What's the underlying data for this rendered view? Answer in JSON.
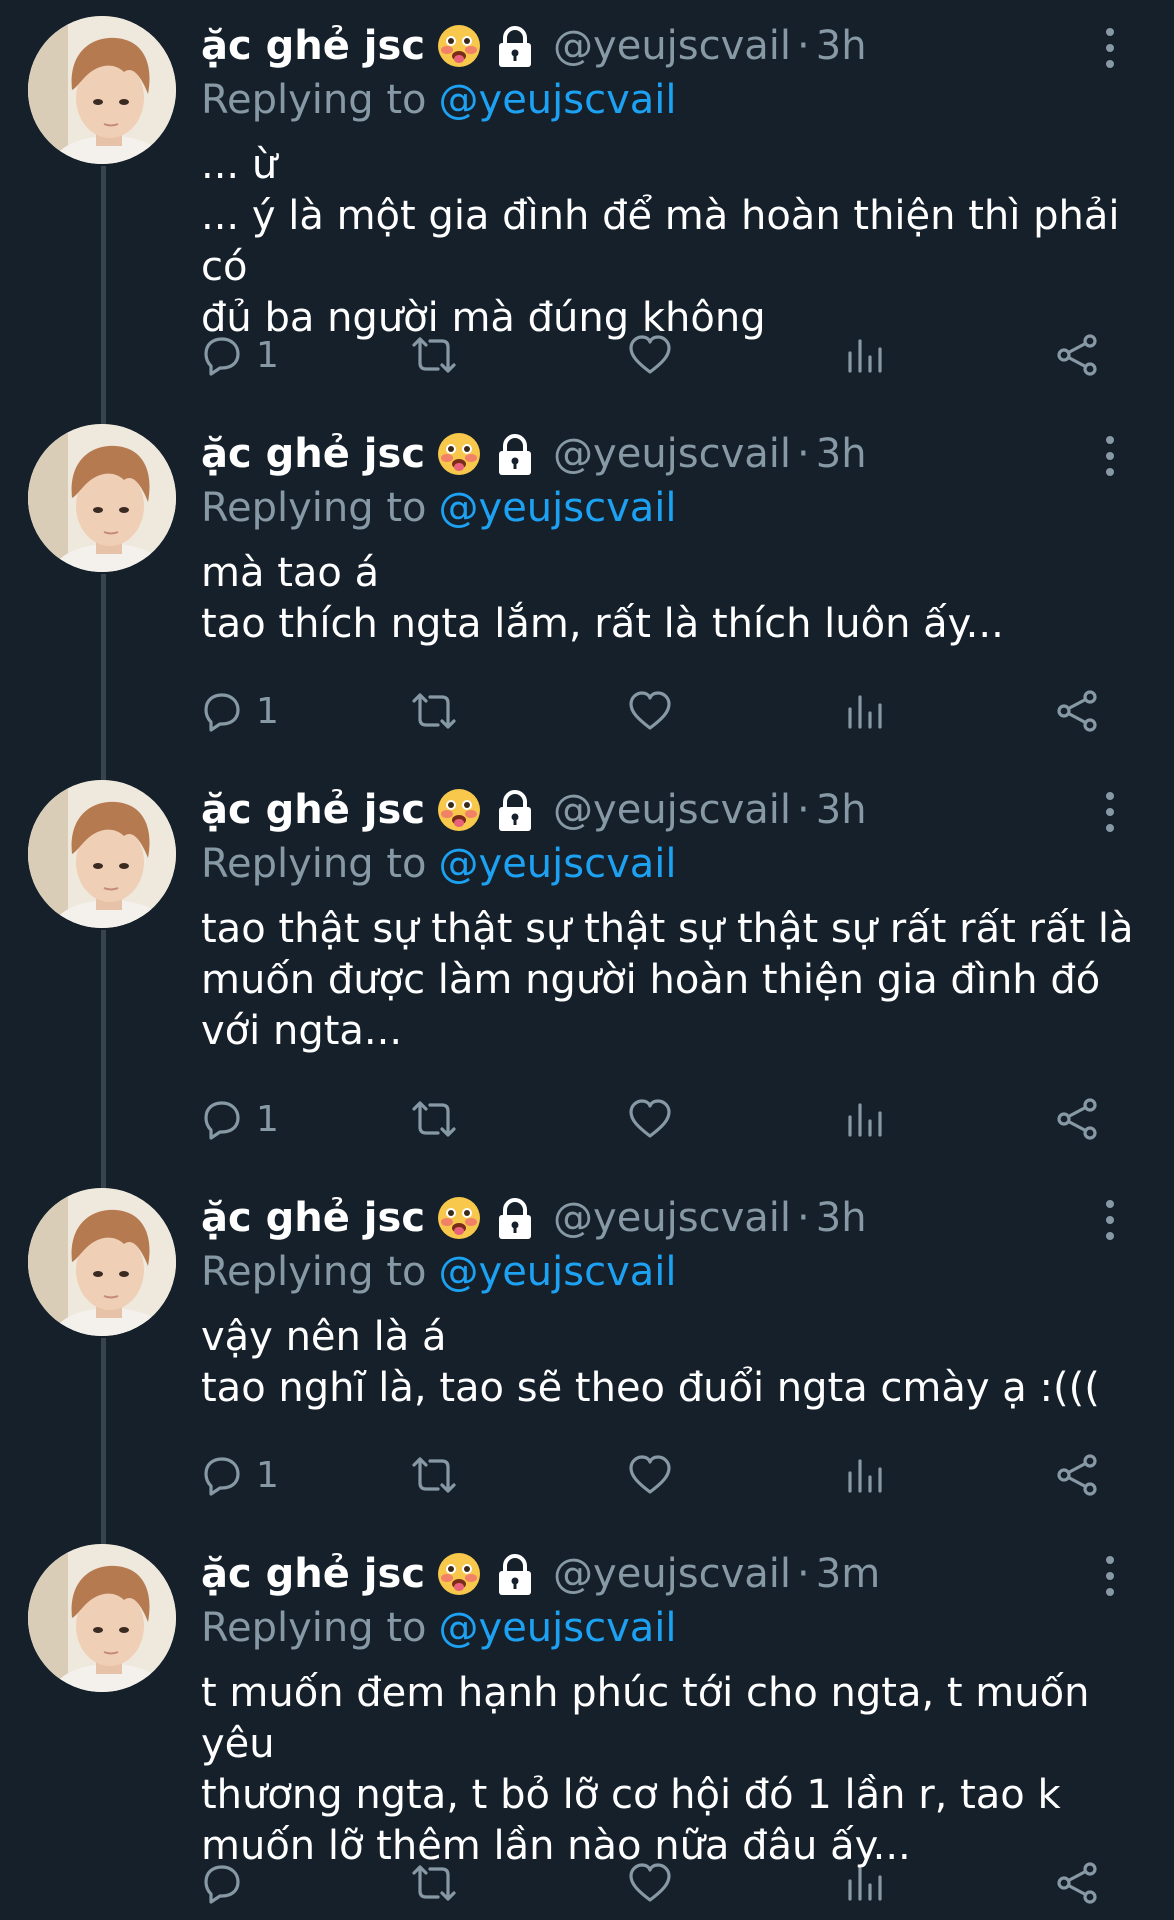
{
  "author": {
    "display_name": "ặc ghẻ jsc",
    "handle": "@yeujscvail",
    "emoji": "flushed-face-with-tongue",
    "protected": true
  },
  "replying_prefix": "Replying to",
  "separator": "·",
  "colors": {
    "background": "#15202b",
    "text": "#ffffff",
    "secondary": "#8899a6",
    "accent": "#1da1f2",
    "thread_line": "#38444d"
  },
  "tweets": [
    {
      "time": "3h",
      "replying_to": "@yeujscvail",
      "lines": [
        "... ừ",
        "... ý là một gia đình để mà hoàn thiện thì phải có",
        "đủ ba người mà đúng không"
      ],
      "reply_count": "1"
    },
    {
      "time": "3h",
      "replying_to": "@yeujscvail",
      "lines": [
        "mà tao á",
        "tao thích ngta lắm, rất là thích luôn ấy..."
      ],
      "reply_count": "1"
    },
    {
      "time": "3h",
      "replying_to": "@yeujscvail",
      "lines": [
        "tao thật sự thật sự thật sự thật sự rất rất rất là",
        "muốn được làm người hoàn thiện gia đình đó",
        "với ngta..."
      ],
      "reply_count": "1"
    },
    {
      "time": "3h",
      "replying_to": "@yeujscvail",
      "lines": [
        "vậy nên là á",
        "tao nghĩ là, tao sẽ theo đuổi ngta cmày ạ :((("
      ],
      "reply_count": "1"
    },
    {
      "time": "3m",
      "replying_to": "@yeujscvail",
      "lines": [
        "t muốn đem hạnh phúc tới cho ngta, t muốn yêu",
        "thương ngta, t bỏ lỡ cơ hội đó 1 lần r, tao k",
        "muốn lỡ thêm lần nào nữa đâu ấy..."
      ],
      "reply_count": ""
    }
  ]
}
